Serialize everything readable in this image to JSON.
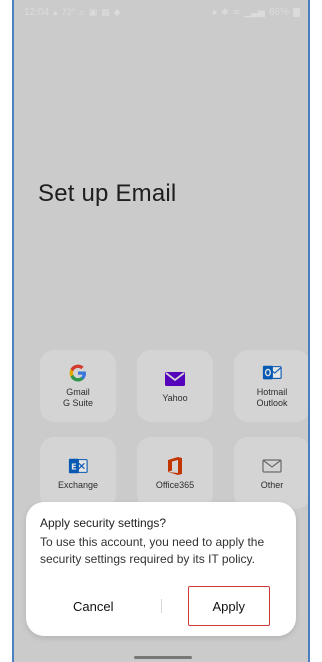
{
  "status_bar": {
    "time": "12:04",
    "temperature": "72°",
    "battery": "86%",
    "left_icons": [
      "notification-icon",
      "home-icon",
      "photo-icon",
      "calendar-icon",
      "store-icon"
    ],
    "right_icons": [
      "alarm-icon",
      "bluetooth-icon",
      "wifi-icon",
      "signal-icon",
      "battery-icon"
    ]
  },
  "page": {
    "title": "Set up Email"
  },
  "providers": [
    {
      "id": "gmail",
      "line1": "Gmail",
      "line2": "G Suite",
      "icon": "google-icon",
      "color": "#4285F4"
    },
    {
      "id": "yahoo",
      "line1": "Yahoo",
      "line2": "",
      "icon": "yahoo-mail-icon",
      "color": "#5f01d1"
    },
    {
      "id": "hotmail",
      "line1": "Hotmail",
      "line2": "Outlook",
      "icon": "outlook-icon",
      "color": "#0a64c8"
    },
    {
      "id": "exchange",
      "line1": "Exchange",
      "line2": "",
      "icon": "exchange-icon",
      "color": "#0a64c8"
    },
    {
      "id": "office365",
      "line1": "Office365",
      "line2": "",
      "icon": "office-icon",
      "color": "#d83b01"
    },
    {
      "id": "other",
      "line1": "Other",
      "line2": "",
      "icon": "envelope-icon",
      "color": "#777777"
    }
  ],
  "dialog": {
    "title": "Apply security settings?",
    "message": "To use this account, you need to apply the security settings required by its IT policy.",
    "cancel_label": "Cancel",
    "apply_label": "Apply",
    "highlight_color": "#d13b3b"
  }
}
